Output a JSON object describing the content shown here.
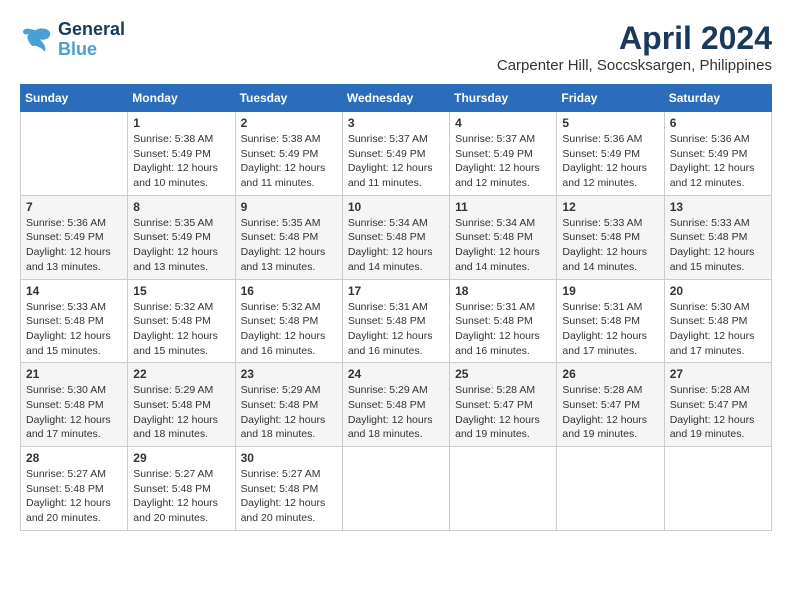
{
  "logo": {
    "line1": "General",
    "line2": "Blue"
  },
  "title": "April 2024",
  "subtitle": "Carpenter Hill, Soccsksargen, Philippines",
  "weekdays": [
    "Sunday",
    "Monday",
    "Tuesday",
    "Wednesday",
    "Thursday",
    "Friday",
    "Saturday"
  ],
  "weeks": [
    [
      {
        "day": "",
        "info": ""
      },
      {
        "day": "1",
        "info": "Sunrise: 5:38 AM\nSunset: 5:49 PM\nDaylight: 12 hours\nand 10 minutes."
      },
      {
        "day": "2",
        "info": "Sunrise: 5:38 AM\nSunset: 5:49 PM\nDaylight: 12 hours\nand 11 minutes."
      },
      {
        "day": "3",
        "info": "Sunrise: 5:37 AM\nSunset: 5:49 PM\nDaylight: 12 hours\nand 11 minutes."
      },
      {
        "day": "4",
        "info": "Sunrise: 5:37 AM\nSunset: 5:49 PM\nDaylight: 12 hours\nand 12 minutes."
      },
      {
        "day": "5",
        "info": "Sunrise: 5:36 AM\nSunset: 5:49 PM\nDaylight: 12 hours\nand 12 minutes."
      },
      {
        "day": "6",
        "info": "Sunrise: 5:36 AM\nSunset: 5:49 PM\nDaylight: 12 hours\nand 12 minutes."
      }
    ],
    [
      {
        "day": "7",
        "info": "Sunrise: 5:36 AM\nSunset: 5:49 PM\nDaylight: 12 hours\nand 13 minutes."
      },
      {
        "day": "8",
        "info": "Sunrise: 5:35 AM\nSunset: 5:49 PM\nDaylight: 12 hours\nand 13 minutes."
      },
      {
        "day": "9",
        "info": "Sunrise: 5:35 AM\nSunset: 5:48 PM\nDaylight: 12 hours\nand 13 minutes."
      },
      {
        "day": "10",
        "info": "Sunrise: 5:34 AM\nSunset: 5:48 PM\nDaylight: 12 hours\nand 14 minutes."
      },
      {
        "day": "11",
        "info": "Sunrise: 5:34 AM\nSunset: 5:48 PM\nDaylight: 12 hours\nand 14 minutes."
      },
      {
        "day": "12",
        "info": "Sunrise: 5:33 AM\nSunset: 5:48 PM\nDaylight: 12 hours\nand 14 minutes."
      },
      {
        "day": "13",
        "info": "Sunrise: 5:33 AM\nSunset: 5:48 PM\nDaylight: 12 hours\nand 15 minutes."
      }
    ],
    [
      {
        "day": "14",
        "info": "Sunrise: 5:33 AM\nSunset: 5:48 PM\nDaylight: 12 hours\nand 15 minutes."
      },
      {
        "day": "15",
        "info": "Sunrise: 5:32 AM\nSunset: 5:48 PM\nDaylight: 12 hours\nand 15 minutes."
      },
      {
        "day": "16",
        "info": "Sunrise: 5:32 AM\nSunset: 5:48 PM\nDaylight: 12 hours\nand 16 minutes."
      },
      {
        "day": "17",
        "info": "Sunrise: 5:31 AM\nSunset: 5:48 PM\nDaylight: 12 hours\nand 16 minutes."
      },
      {
        "day": "18",
        "info": "Sunrise: 5:31 AM\nSunset: 5:48 PM\nDaylight: 12 hours\nand 16 minutes."
      },
      {
        "day": "19",
        "info": "Sunrise: 5:31 AM\nSunset: 5:48 PM\nDaylight: 12 hours\nand 17 minutes."
      },
      {
        "day": "20",
        "info": "Sunrise: 5:30 AM\nSunset: 5:48 PM\nDaylight: 12 hours\nand 17 minutes."
      }
    ],
    [
      {
        "day": "21",
        "info": "Sunrise: 5:30 AM\nSunset: 5:48 PM\nDaylight: 12 hours\nand 17 minutes."
      },
      {
        "day": "22",
        "info": "Sunrise: 5:29 AM\nSunset: 5:48 PM\nDaylight: 12 hours\nand 18 minutes."
      },
      {
        "day": "23",
        "info": "Sunrise: 5:29 AM\nSunset: 5:48 PM\nDaylight: 12 hours\nand 18 minutes."
      },
      {
        "day": "24",
        "info": "Sunrise: 5:29 AM\nSunset: 5:48 PM\nDaylight: 12 hours\nand 18 minutes."
      },
      {
        "day": "25",
        "info": "Sunrise: 5:28 AM\nSunset: 5:47 PM\nDaylight: 12 hours\nand 19 minutes."
      },
      {
        "day": "26",
        "info": "Sunrise: 5:28 AM\nSunset: 5:47 PM\nDaylight: 12 hours\nand 19 minutes."
      },
      {
        "day": "27",
        "info": "Sunrise: 5:28 AM\nSunset: 5:47 PM\nDaylight: 12 hours\nand 19 minutes."
      }
    ],
    [
      {
        "day": "28",
        "info": "Sunrise: 5:27 AM\nSunset: 5:48 PM\nDaylight: 12 hours\nand 20 minutes."
      },
      {
        "day": "29",
        "info": "Sunrise: 5:27 AM\nSunset: 5:48 PM\nDaylight: 12 hours\nand 20 minutes."
      },
      {
        "day": "30",
        "info": "Sunrise: 5:27 AM\nSunset: 5:48 PM\nDaylight: 12 hours\nand 20 minutes."
      },
      {
        "day": "",
        "info": ""
      },
      {
        "day": "",
        "info": ""
      },
      {
        "day": "",
        "info": ""
      },
      {
        "day": "",
        "info": ""
      }
    ]
  ]
}
